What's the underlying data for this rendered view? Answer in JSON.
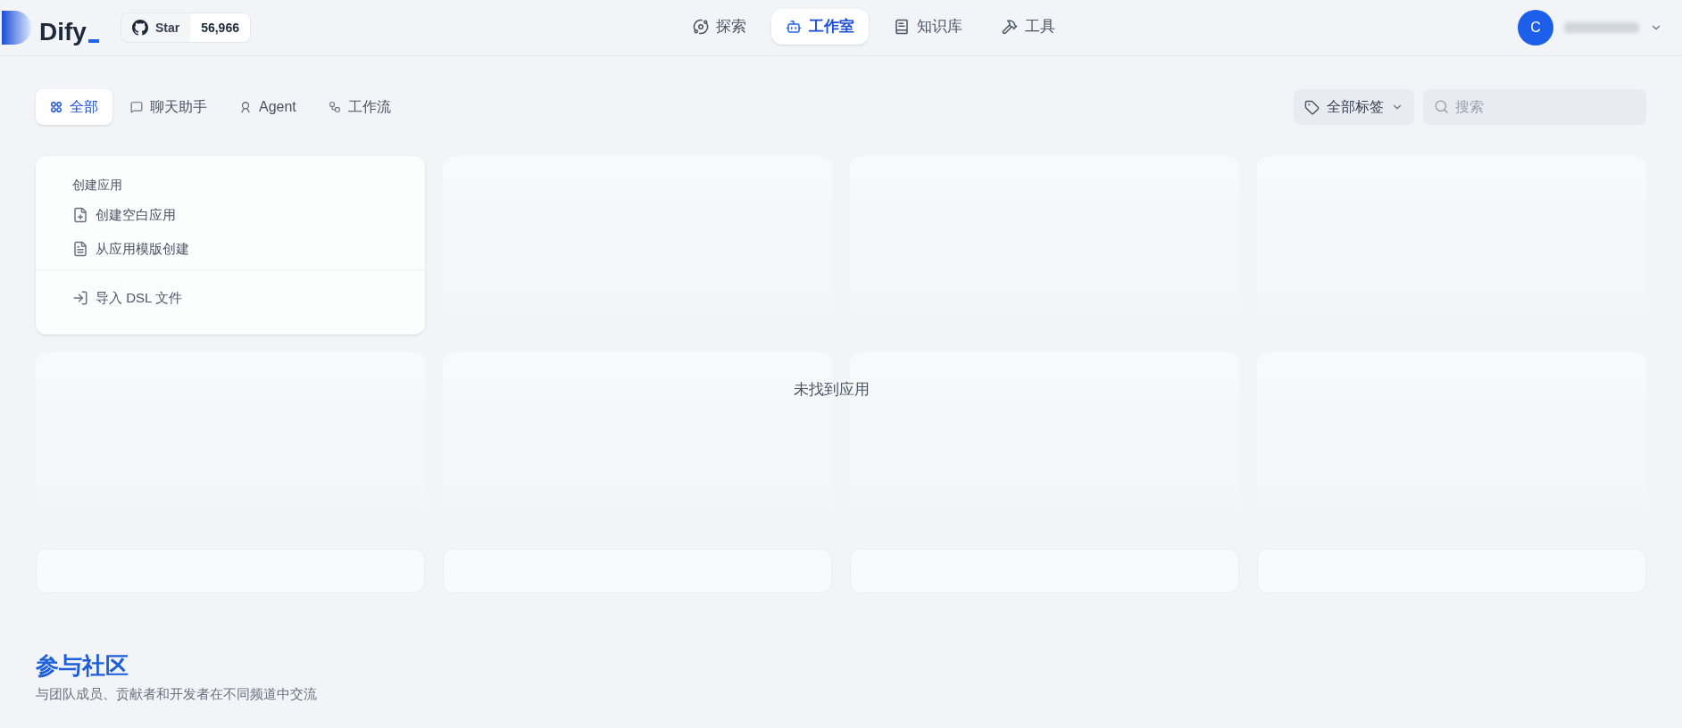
{
  "header": {
    "logo": "Dify",
    "github": {
      "label": "Star",
      "count": "56,966"
    },
    "nav": [
      {
        "label": "探索",
        "kind": "explore",
        "selected": false
      },
      {
        "label": "工作室",
        "kind": "studio",
        "selected": true
      },
      {
        "label": "知识库",
        "kind": "knowledge",
        "selected": false
      },
      {
        "label": "工具",
        "kind": "tools",
        "selected": false
      }
    ],
    "avatar": "C"
  },
  "filters": [
    {
      "label": "全部",
      "kind": "all",
      "selected": true
    },
    {
      "label": "聊天助手",
      "kind": "chat",
      "selected": false
    },
    {
      "label": "Agent",
      "kind": "agent",
      "selected": false
    },
    {
      "label": "工作流",
      "kind": "workflow",
      "selected": false
    }
  ],
  "tag_filter": "全部标签",
  "search": {
    "placeholder": "搜索"
  },
  "create_card": {
    "title": "创建应用",
    "items": [
      {
        "label": "创建空白应用",
        "kind": "blank"
      },
      {
        "label": "从应用模版创建",
        "kind": "template"
      },
      {
        "label": "导入 DSL 文件",
        "kind": "import"
      }
    ]
  },
  "empty_message": "未找到应用",
  "community": {
    "title": "参与社区",
    "description": "与团队成员、贡献者和开发者在不同频道中交流"
  }
}
